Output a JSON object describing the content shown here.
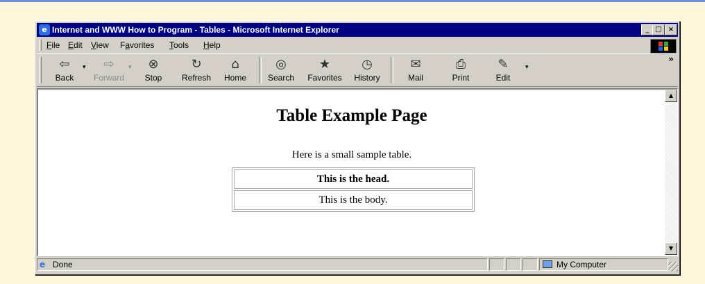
{
  "window": {
    "title": "Internet and WWW How to Program - Tables - Microsoft Internet Explorer",
    "controls": {
      "minimize": "_",
      "maximize": "□",
      "close": "×"
    }
  },
  "menu": [
    {
      "pre": "",
      "key": "F",
      "post": "ile"
    },
    {
      "pre": "",
      "key": "E",
      "post": "dit"
    },
    {
      "pre": "",
      "key": "V",
      "post": "iew"
    },
    {
      "pre": "F",
      "key": "a",
      "post": "vorites"
    },
    {
      "pre": "",
      "key": "T",
      "post": "ools"
    },
    {
      "pre": "",
      "key": "H",
      "post": "elp"
    }
  ],
  "toolbar": {
    "back": "Back",
    "forward": "Forward",
    "stop": "Stop",
    "refresh": "Refresh",
    "home": "Home",
    "search": "Search",
    "favorites": "Favorites",
    "history": "History",
    "mail": "Mail",
    "print": "Print",
    "edit": "Edit",
    "more": "»",
    "dropdown": "▾"
  },
  "icons": {
    "back": "back-arrow-icon",
    "forward": "forward-arrow-icon",
    "stop": "stop-icon",
    "refresh": "refresh-icon",
    "home": "home-icon",
    "search": "search-icon",
    "favorites": "favorites-icon",
    "history": "history-icon",
    "mail": "mail-icon",
    "print": "print-icon",
    "edit": "edit-icon"
  },
  "page": {
    "heading": "Table Example Page",
    "intro": "Here is a small sample table.",
    "table": {
      "head": "This is the head.",
      "body": "This is the body."
    }
  },
  "status": {
    "text": "Done",
    "zone": "My Computer"
  },
  "colors": {
    "titlebar": "#000080",
    "chrome": "#d4d0c8",
    "panel": "#fff7dc",
    "accent_rule": "#6e8fd6"
  }
}
